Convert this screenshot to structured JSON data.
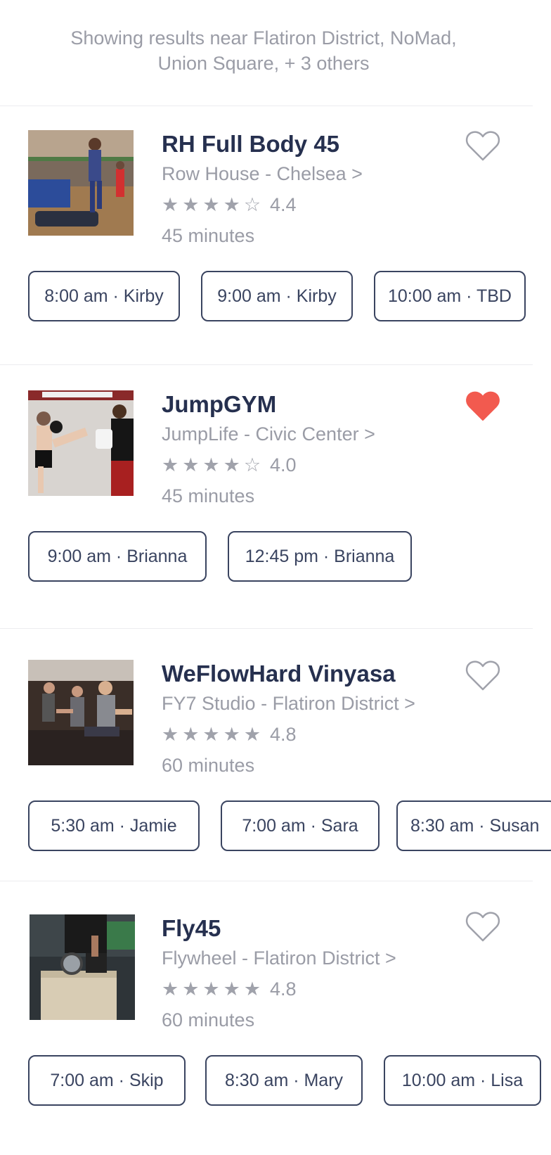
{
  "header": {
    "line1": "Showing results near Flatiron District, NoMad,",
    "line2": "Union Square, + 3 others"
  },
  "colors": {
    "title": "#26304f",
    "muted": "#9a9ca6",
    "slot_border": "#3a4460",
    "heart_active": "#f25a4f",
    "heart_inactive": "#a0a2ab"
  },
  "classes": [
    {
      "title": "RH Full Body 45",
      "studio": "Row House - Chelsea >",
      "stars": "★★★★☆",
      "rating": "4.4",
      "duration": "45 minutes",
      "favorited": false,
      "slots": [
        "8:00 am · Kirby",
        "9:00 am · Kirby",
        "10:00 am · TBD"
      ]
    },
    {
      "title": "JumpGYM",
      "studio": "JumpLife - Civic Center >",
      "stars": "★★★★☆",
      "rating": "4.0",
      "duration": "45 minutes",
      "favorited": true,
      "slots": [
        "9:00 am · Brianna",
        "12:45 pm · Brianna"
      ]
    },
    {
      "title": "WeFlowHard Vinyasa",
      "studio": "FY7 Studio - Flatiron District >",
      "stars": "★★★★★",
      "rating": "4.8",
      "duration": "60 minutes",
      "favorited": false,
      "slots": [
        "5:30 am · Jamie",
        "7:00 am · Sara",
        "8:30 am · Susan"
      ]
    },
    {
      "title": "Fly45",
      "studio": "Flywheel - Flatiron District >",
      "stars": "★★★★★",
      "rating": "4.8",
      "duration": "60 minutes",
      "favorited": false,
      "slots": [
        "7:00 am · Skip",
        "8:30 am · Mary",
        "10:00 am · Lisa"
      ]
    }
  ]
}
